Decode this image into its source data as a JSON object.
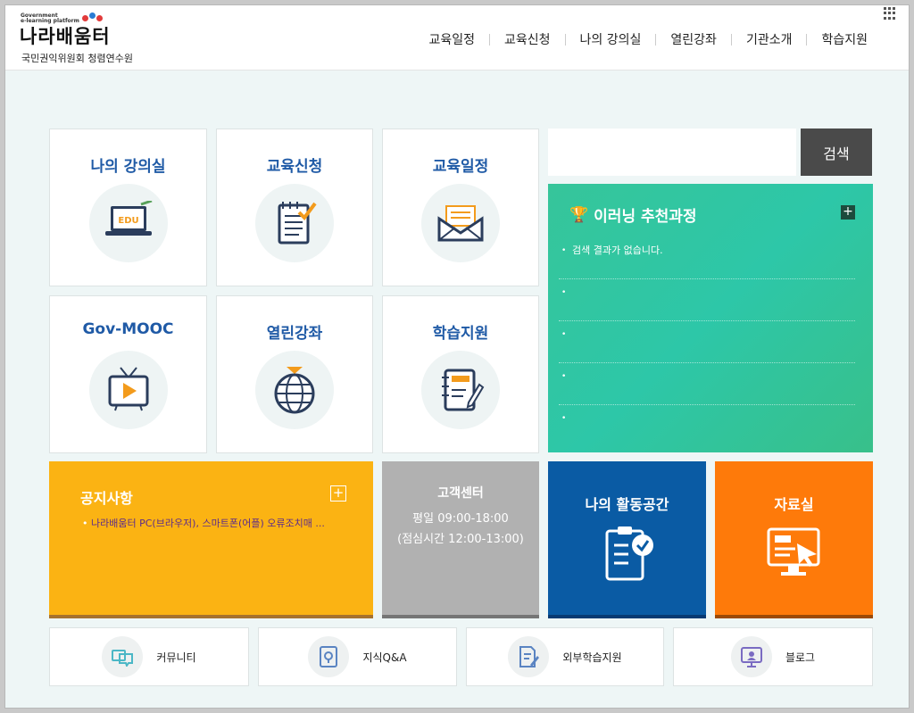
{
  "header": {
    "logo_small_line1": "Government",
    "logo_small_line2": "e-learning platform",
    "logo_main": "나라배움터",
    "logo_sub": "국민권익위원회 청렴연수원",
    "nav": [
      "교육일정",
      "교육신청",
      "나의 강의실",
      "열린강좌",
      "기관소개",
      "학습지원"
    ]
  },
  "tiles": [
    {
      "label": "나의 강의실",
      "icon": "edu-laptop-icon",
      "badge": "EDU"
    },
    {
      "label": "교육신청",
      "icon": "notepad-check-icon"
    },
    {
      "label": "교육일정",
      "icon": "envelope-icon"
    },
    {
      "label": "Gov-MOOC",
      "icon": "tv-play-icon"
    },
    {
      "label": "열린강좌",
      "icon": "globe-icon"
    },
    {
      "label": "학습지원",
      "icon": "notebook-pencil-icon"
    }
  ],
  "search": {
    "placeholder": "",
    "button": "검색"
  },
  "recommend": {
    "title": "이러닝 추천과정",
    "plus": "+",
    "items": [
      "검색 결과가 없습니다.",
      "",
      "",
      "",
      ""
    ],
    "color": "#36c59a"
  },
  "notice": {
    "title": "공지사항",
    "plus": "+",
    "item": "나라배움터 PC(브라우저), 스마트폰(어플) 오류조치매 ...",
    "color": "#fbb313"
  },
  "customer_center": {
    "title": "고객센터",
    "hours": "평일 09:00-18:00",
    "lunch": "(점심시간 12:00-13:00)"
  },
  "activity": {
    "title": "나의 활동공간",
    "icon": "clipboard-check-icon",
    "color": "#0a5ba4"
  },
  "archive": {
    "title": "자료실",
    "icon": "monitor-cursor-icon",
    "color": "#fe7a0a"
  },
  "bottom_links": [
    {
      "label": "커뮤니티",
      "icon": "chat-bubbles-icon"
    },
    {
      "label": "지식Q&A",
      "icon": "book-pin-icon"
    },
    {
      "label": "외부학습지원",
      "icon": "document-pencil-icon"
    },
    {
      "label": "블로그",
      "icon": "blog-monitor-icon"
    }
  ]
}
